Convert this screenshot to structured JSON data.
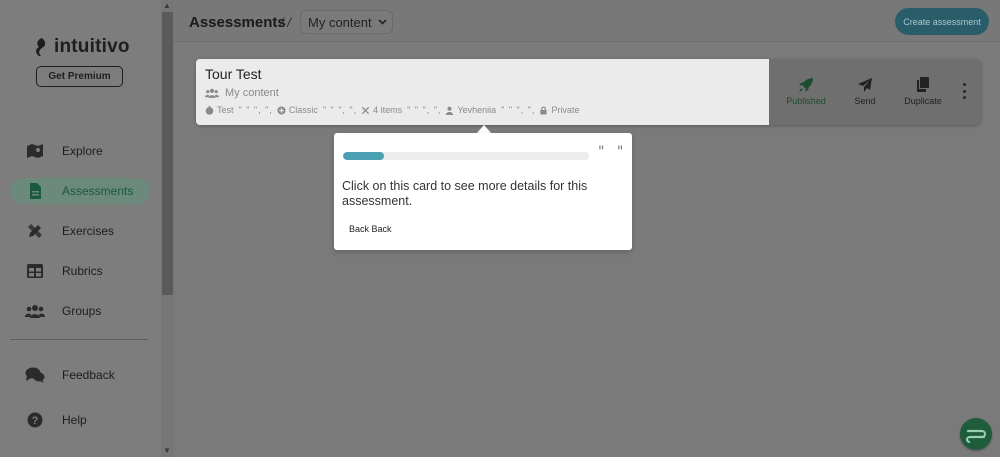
{
  "app": {
    "brand": "intuitivo",
    "premium_label": "Get Premium"
  },
  "sidebar": {
    "items": [
      {
        "label": "Explore",
        "icon": "map-icon"
      },
      {
        "label": "Assessments",
        "icon": "document-icon",
        "active": true
      },
      {
        "label": "Exercises",
        "icon": "pencil-ruler-icon"
      },
      {
        "label": "Rubrics",
        "icon": "table-icon"
      },
      {
        "label": "Groups",
        "icon": "users-icon"
      }
    ],
    "footer_items": [
      {
        "label": "Feedback",
        "icon": "comments-icon"
      },
      {
        "label": "Help",
        "icon": "question-circle-icon"
      }
    ]
  },
  "header": {
    "title": "Assessments",
    "separator": "/ /",
    "folder": "My content",
    "create_label": "Create assessment"
  },
  "card": {
    "title": "Tour Test",
    "folder": "My content",
    "meta": [
      {
        "label": "Test",
        "icon": "stopwatch-icon"
      },
      {
        "label": "Classic",
        "icon": "circle-plus-icon"
      },
      {
        "label": "4 items",
        "icon": "tools-icon"
      },
      {
        "label": "Yevheniia",
        "icon": "user-icon"
      },
      {
        "label": "Private",
        "icon": "lock-icon"
      }
    ],
    "meta_quote": "\" \" \", \",",
    "actions": [
      {
        "label": "Published",
        "icon": "rocket-icon"
      },
      {
        "label": "Send",
        "icon": "paper-plane-icon"
      },
      {
        "label": "Duplicate",
        "icon": "copy-icon"
      }
    ]
  },
  "tooltip": {
    "progress": 0.165,
    "close_symbol": "\" \"",
    "text": "Click on this card to see more details for this assessment.",
    "back_label": "Back Back"
  },
  "colors": {
    "accent": "#2a5d6a",
    "progress": "#4a9fb3",
    "published": "#1d4c30",
    "fab": "#1f5c3b"
  }
}
